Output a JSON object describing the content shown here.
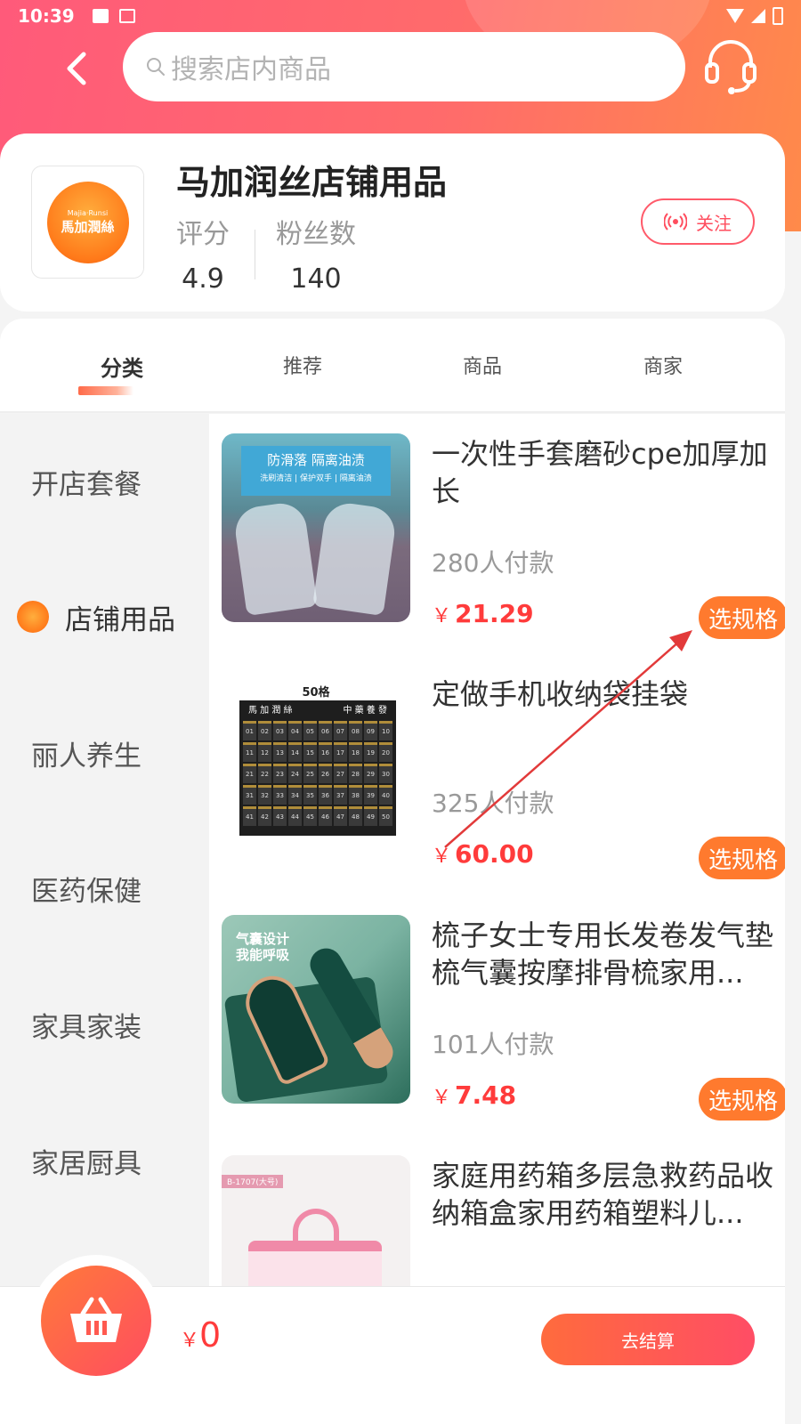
{
  "status_bar": {
    "time": "10:39"
  },
  "search": {
    "placeholder": "搜索店内商品"
  },
  "store": {
    "name": "马加润丝店铺用品",
    "logo_text_en": "Majia·Runsi",
    "logo_text_cn": "馬加潤絲",
    "rating_label": "评分",
    "rating_value": "4.9",
    "fans_label": "粉丝数",
    "fans_value": "140",
    "follow_label": "关注"
  },
  "tabs": [
    {
      "label": "分类",
      "active": true
    },
    {
      "label": "推荐",
      "active": false
    },
    {
      "label": "商品",
      "active": false
    },
    {
      "label": "商家",
      "active": false
    }
  ],
  "categories": [
    {
      "label": "开店套餐"
    },
    {
      "label": "店铺用品",
      "active": true
    },
    {
      "label": "丽人养生"
    },
    {
      "label": "医药保健"
    },
    {
      "label": "家具家装"
    },
    {
      "label": "家居厨具"
    }
  ],
  "products": [
    {
      "title": "一次性手套磨砂cpe加厚加长",
      "sales": "280人付款",
      "currency": "￥",
      "price": "21.29",
      "spec_label": "选规格",
      "image": {
        "banner_main": "防滑落 隔离油渍",
        "banner_sub": "洗刷清洁 | 保护双手 | 隔离油渍"
      }
    },
    {
      "title": "定做手机收纳袋挂袋",
      "sales": "325人付款",
      "currency": "￥",
      "price": "60.00",
      "spec_label": "选规格",
      "image": {
        "top_label": "50格",
        "left_text": "馬 加 潤 絲",
        "right_text": "中 藥 養 發"
      }
    },
    {
      "title": "梳子女士专用长发卷发气垫梳气囊按摩排骨梳家用...",
      "sales": "101人付款",
      "currency": "￥",
      "price": "7.48",
      "spec_label": "选规格",
      "image": {
        "text_line1": "气囊设计",
        "text_line2": "我能呼吸"
      }
    },
    {
      "title": "家庭用药箱多层急救药品收纳箱盒家用药箱塑料儿...",
      "sales": "",
      "currency": "",
      "price": "",
      "spec_label": "",
      "image": {
        "tag": "B-1707(大号)"
      }
    }
  ],
  "bottom_bar": {
    "currency": "￥",
    "total": "0",
    "checkout_label": "去结算"
  },
  "colors": {
    "header_gradient_start": "#ff5a7a",
    "header_gradient_end": "#ff8a4a",
    "price_red": "#ff3b3b",
    "spec_orange": "#ff7a2e",
    "arrow_red": "#e23a3a"
  },
  "icons": [
    "back-arrow-icon",
    "search-icon",
    "headset-icon",
    "broadcast-icon",
    "basket-icon"
  ]
}
